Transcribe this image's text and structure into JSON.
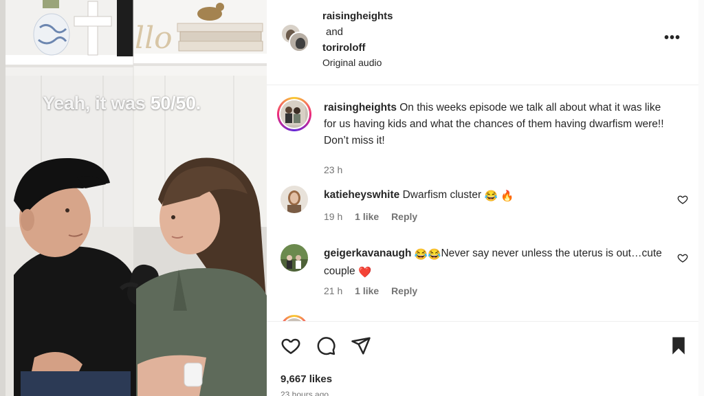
{
  "video": {
    "caption_prefix": "Yeah, it was ",
    "caption_highlight": "50/50.",
    "shelf_sign": "llo"
  },
  "header": {
    "user1": "raisingheights",
    "joiner": "and",
    "user2": "toriroloff",
    "audio": "Original audio",
    "more_icon": "more-horizontal-icon"
  },
  "caption_comment": {
    "username": "raisingheights",
    "text": "On this weeks episode we talk all about what it was like for us having kids and what the chances of them having dwarfism were!! Don’t miss it!",
    "time": "23 h"
  },
  "comments": [
    {
      "username": "katieheyswhite",
      "text": "Dwarfism cluster",
      "emojis": [
        "😂",
        "🔥"
      ],
      "time": "19 h",
      "likes": "1 like",
      "reply": "Reply"
    },
    {
      "username": "geigerkavanaugh",
      "prefix_emojis": [
        "😂",
        "😂"
      ],
      "text": "Never say never unless the uterus is out…cute couple",
      "suffix_emoji": "❤️",
      "time": "21 h",
      "likes": "1 like",
      "reply": "Reply"
    }
  ],
  "footer": {
    "likes": "9,667 likes",
    "ago": "23 hours ago",
    "icons": [
      "heart-icon",
      "comment-icon",
      "share-icon",
      "bookmark-icon"
    ]
  },
  "colors": {
    "text": "#262626",
    "secondary": "#737373",
    "divider": "#efefef",
    "heart_red": "#e0245e"
  }
}
